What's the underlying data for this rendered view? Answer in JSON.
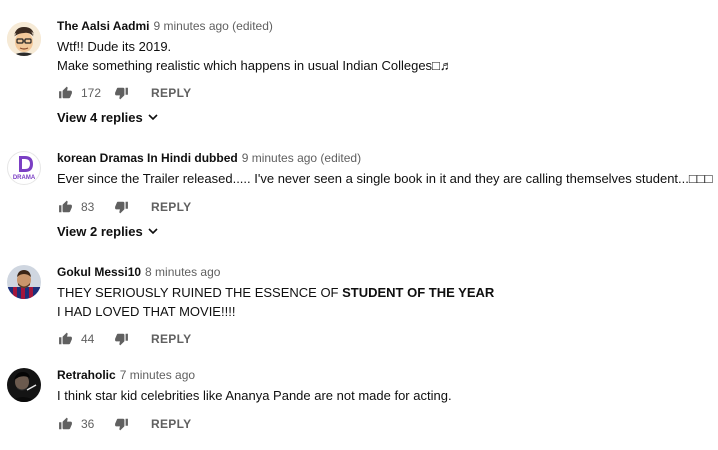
{
  "comments": [
    {
      "author": "The Aalsi Aadmi",
      "time": "9 minutes ago (edited)",
      "lines": [
        "Wtf!! Dude its 2019.",
        "Make something realistic which happens in usual Indian Colleges□♬"
      ],
      "likes": "172",
      "reply_label": "REPLY",
      "view_replies": "View 4 replies"
    },
    {
      "author": "korean Dramas In Hindi dubbed",
      "time": "9 minutes ago (edited)",
      "lines": [
        "Ever since the Trailer released..... I've never seen a single book in it and they are calling themselves student...□□□"
      ],
      "avatar_text": "DRAMA",
      "likes": "83",
      "reply_label": "REPLY",
      "view_replies": "View 2 replies"
    },
    {
      "author": "Gokul Messi10",
      "time": "8 minutes ago",
      "line1_plain": "THEY SERIOUSLY RUINED THE ESSENCE OF ",
      "line1_bold": "STUDENT OF THE YEAR",
      "line2": "I HAD LOVED THAT MOVIE!!!!",
      "likes": "44",
      "reply_label": "REPLY"
    },
    {
      "author": "Retraholic",
      "time": "7 minutes ago",
      "lines": [
        "I think star kid celebrities like Ananya Pande are not made for acting."
      ],
      "likes": "36",
      "reply_label": "REPLY"
    }
  ],
  "colors": {
    "text": "#0f0f0f",
    "secondary": "#606060",
    "drama": "#7b3fc4"
  }
}
